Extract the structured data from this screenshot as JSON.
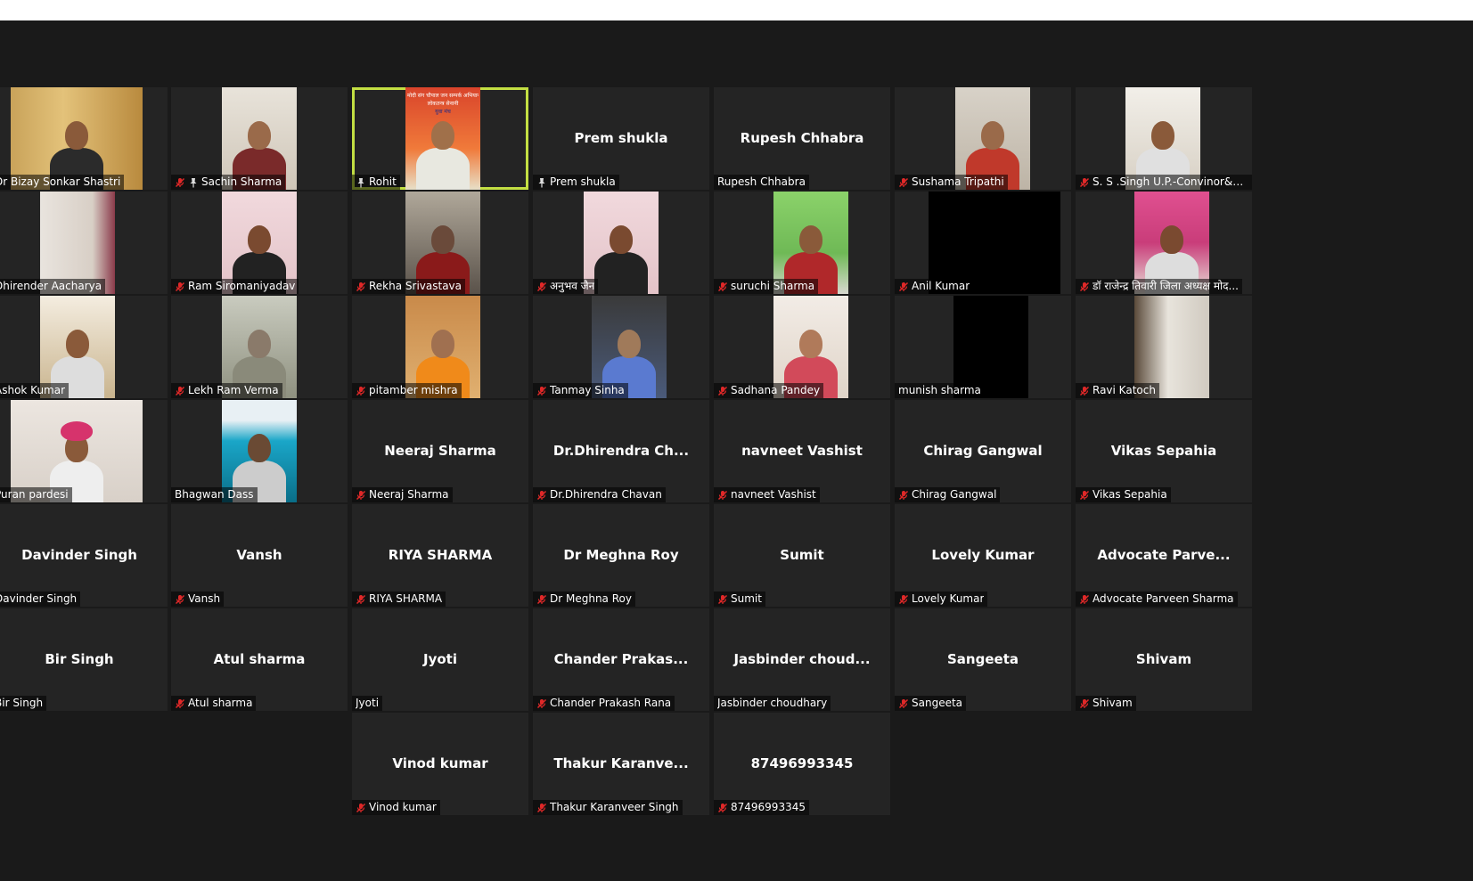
{
  "colors": {
    "background": "#1a1a1a",
    "tile": "#242424",
    "active_border": "#c3df43",
    "mute_red": "#e02828"
  },
  "participants": [
    {
      "label": "Dr Bizay Sonkar Shastri",
      "icon": "none",
      "video": "warm"
    },
    {
      "label": "Sachin Sharma",
      "icon": "muted-pinned",
      "video": "light"
    },
    {
      "label": "Rohit",
      "icon": "pinned",
      "video": "poster",
      "active": true
    },
    {
      "label": "Prem shukla",
      "big": "Prem shukla",
      "icon": "pinned"
    },
    {
      "label": "Rupesh Chhabra",
      "big": "Rupesh Chhabra",
      "icon": "none"
    },
    {
      "label": "Sushama Tripathi",
      "icon": "muted",
      "video": "woman"
    },
    {
      "label": "S. S .Singh  U.P.-Convinor&All ...",
      "icon": "muted",
      "video": "room"
    },
    {
      "label": "Dhirender Aacharya",
      "icon": "none",
      "video": "wall"
    },
    {
      "label": "Ram Siromaniyadav",
      "icon": "muted",
      "video": "pinkwall"
    },
    {
      "label": "Rekha Srivastava",
      "icon": "muted",
      "video": "dark"
    },
    {
      "label": "अनुभव जैन",
      "icon": "muted",
      "video": "pinkwall"
    },
    {
      "label": "suruchi Sharma",
      "icon": "muted",
      "video": "green"
    },
    {
      "label": "Anil Kumar",
      "icon": "muted",
      "video": "black_wide"
    },
    {
      "label": "डॉ राजेन्द्र तिवारी जिला अध्यक्ष मोद...",
      "icon": "muted",
      "video": "pink"
    },
    {
      "label": "Ashok Kumar",
      "icon": "none",
      "video": "cream"
    },
    {
      "label": "Lekh Ram Verma",
      "icon": "muted",
      "video": "blurry"
    },
    {
      "label": "pitamber mishra",
      "icon": "muted",
      "video": "orange"
    },
    {
      "label": "Tanmay Sinha",
      "icon": "muted",
      "video": "blue"
    },
    {
      "label": "Sadhana Pandey",
      "icon": "muted",
      "video": "woman2"
    },
    {
      "label": "munish sharma",
      "icon": "none",
      "video": "black"
    },
    {
      "label": "Ravi Katoch",
      "icon": "muted",
      "video": "door"
    },
    {
      "label": "Puran pardesi",
      "icon": "none",
      "video": "turban"
    },
    {
      "label": "Bhagwan Dass",
      "icon": "none",
      "video": "curtain"
    },
    {
      "label": "Neeraj Sharma",
      "big": "Neeraj Sharma",
      "icon": "muted"
    },
    {
      "label": "Dr.Dhirendra Chavan",
      "big": "Dr.Dhirendra  Ch...",
      "icon": "muted"
    },
    {
      "label": "navneet Vashist",
      "big": "navneet Vashist",
      "icon": "muted"
    },
    {
      "label": "Chirag Gangwal",
      "big": "Chirag Gangwal",
      "icon": "muted"
    },
    {
      "label": "Vikas Sepahia",
      "big": "Vikas Sepahia",
      "icon": "muted"
    },
    {
      "label": "Davinder Singh",
      "big": "Davinder Singh",
      "icon": "none"
    },
    {
      "label": "Vansh",
      "big": "Vansh",
      "icon": "muted"
    },
    {
      "label": "RIYA SHARMA",
      "big": "RIYA SHARMA",
      "icon": "muted"
    },
    {
      "label": "Dr Meghna Roy",
      "big": "Dr Meghna Roy",
      "icon": "muted"
    },
    {
      "label": "Sumit",
      "big": "Sumit",
      "icon": "muted"
    },
    {
      "label": "Lovely Kumar",
      "big": "Lovely Kumar",
      "icon": "muted"
    },
    {
      "label": "Advocate Parveen Sharma",
      "big": "Advocate  Parve...",
      "icon": "muted"
    },
    {
      "label": "Bir Singh",
      "big": "Bir Singh",
      "icon": "none"
    },
    {
      "label": "Atul sharma",
      "big": "Atul sharma",
      "icon": "muted"
    },
    {
      "label": "Jyoti",
      "big": "Jyoti",
      "icon": "none"
    },
    {
      "label": "Chander Prakash Rana",
      "big": "Chander  Prakas...",
      "icon": "muted"
    },
    {
      "label": "Jasbinder choudhary",
      "big": "Jasbinder  choud...",
      "icon": "none"
    },
    {
      "label": "Sangeeta",
      "big": "Sangeeta",
      "icon": "muted"
    },
    {
      "label": "Shivam",
      "big": "Shivam",
      "icon": "muted"
    },
    {
      "label": "Vinod kumar",
      "big": "Vinod kumar",
      "icon": "muted",
      "col": 2
    },
    {
      "label": "Thakur Karanveer Singh",
      "big": "Thakur  Karanve...",
      "icon": "muted",
      "col": 3
    },
    {
      "label": "87496993345",
      "big": "87496993345",
      "icon": "muted",
      "col": 4
    }
  ],
  "poster": {
    "line1": "मोदी संग चौपाल जन सम्पर्क अभियान",
    "line2": "लोकतन्त्र सेनानी",
    "line3": "युवा मंच"
  }
}
